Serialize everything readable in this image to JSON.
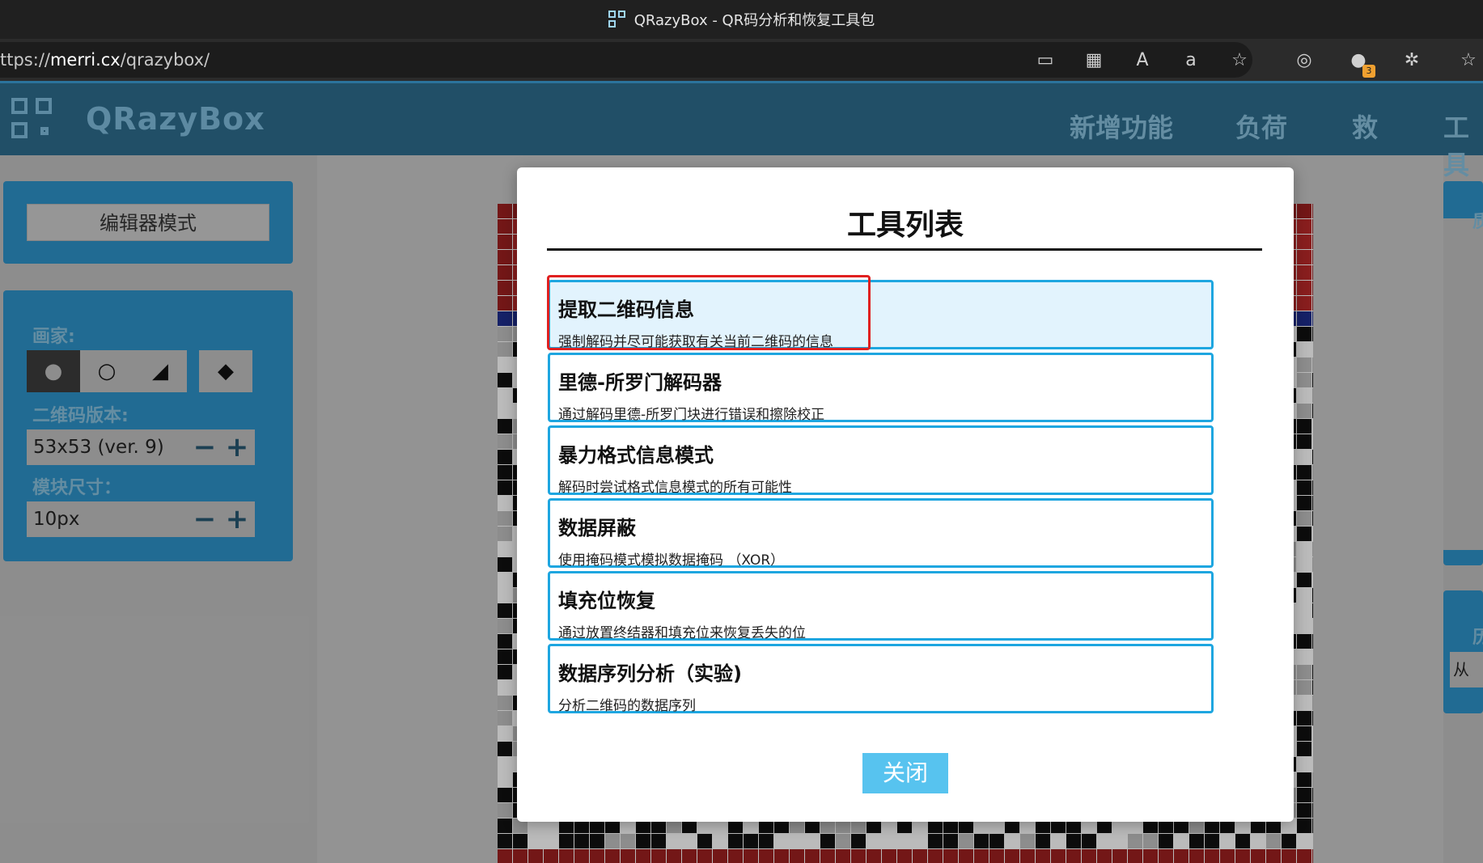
{
  "browser": {
    "tab_title": "QRazyBox - QR码分析和恢复工具包",
    "url_prefix": "ttps://",
    "url_host": "merri.cx",
    "url_path": "/qrazybox/",
    "extension_badge": "3"
  },
  "header": {
    "logo_text": "QRazyBox",
    "nav": [
      "新增功能",
      "负荷",
      "救",
      "工具"
    ]
  },
  "sidebar": {
    "editor_mode_label": "编辑器模式",
    "painter_label": "画家:",
    "version_label": "二维码版本:",
    "version_value": "53x53 (ver. 9)",
    "module_size_label": "模块尺寸：",
    "module_size_value": "10px",
    "minus": "−",
    "plus": "+"
  },
  "modal": {
    "title": "工具列表",
    "tools": [
      {
        "name": "提取二维码信息",
        "desc": "强制解码并尽可能获取有关当前二维码的信息"
      },
      {
        "name": "里德-所罗门解码器",
        "desc": "通过解码里德-所罗门块进行错误和擦除校正"
      },
      {
        "name": "暴力格式信息模式",
        "desc": "解码时尝试格式信息模式的所有可能性"
      },
      {
        "name": "数据屏蔽",
        "desc": "使用掩码模式模拟数据掩码 （XOR）"
      },
      {
        "name": "填充位恢复",
        "desc": "通过放置终结器和填充位来恢复丢失的位"
      },
      {
        "name": "数据序列分析（实验)",
        "desc": "分析二维码的数据序列"
      }
    ],
    "close_label": "关闭"
  },
  "right_panels": {
    "label_a": "质",
    "label_b": "历",
    "label_c": "从"
  },
  "colors": {
    "accent": "#2c8fc4",
    "header_bg": "#2c6a8a",
    "tool_border": "#1ea6e0",
    "highlight": "#e02020",
    "close_button": "#57c3ef"
  }
}
